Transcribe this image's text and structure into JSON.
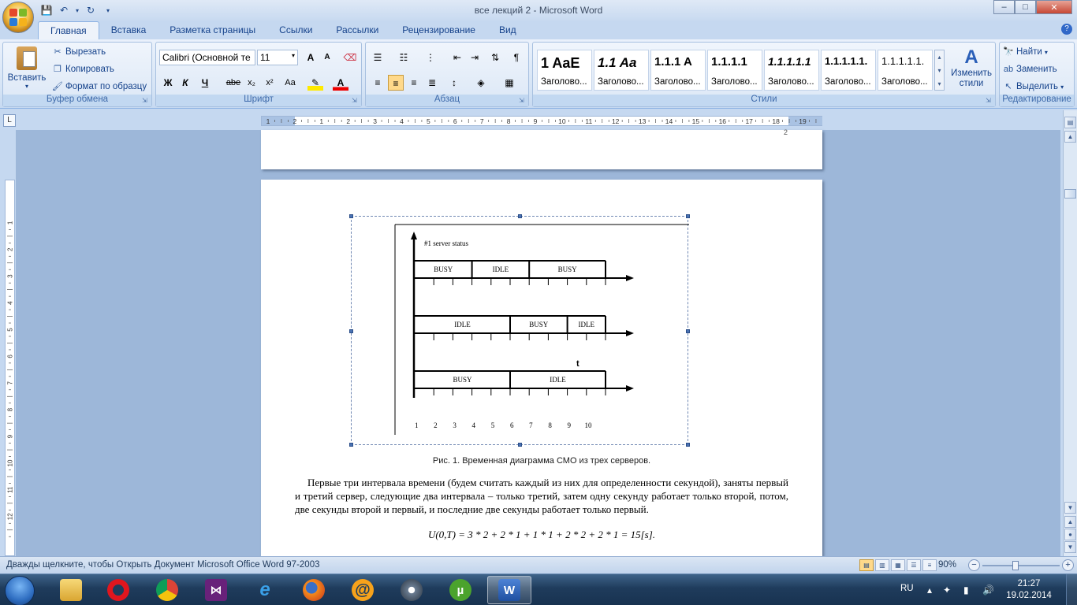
{
  "window": {
    "title": "все лекций 2 - Microsoft Word",
    "controls": [
      "–",
      "□",
      "✕"
    ]
  },
  "tabs": [
    "Главная",
    "Вставка",
    "Разметка страницы",
    "Ссылки",
    "Рассылки",
    "Рецензирование",
    "Вид"
  ],
  "clipboard": {
    "paste": "Вставить",
    "cut": "Вырезать",
    "copy": "Копировать",
    "format_painter": "Формат по образцу",
    "label": "Буфер обмена"
  },
  "font": {
    "name": "Calibri (Основной те",
    "size": "11",
    "label": "Шрифт",
    "bold": "Ж",
    "italic": "К",
    "underline": "Ч",
    "strike": "abe",
    "subscript": "x₂",
    "superscript": "x²",
    "change_case": "Aa",
    "grow": "A",
    "shrink": "A"
  },
  "paragraph": {
    "label": "Абзац"
  },
  "styles": {
    "label": "Стили",
    "items": [
      {
        "sample": "1  AaE",
        "name": "Заголово..."
      },
      {
        "sample": "1.1  Aa",
        "name": "Заголово..."
      },
      {
        "sample": "1.1.1  A",
        "name": "Заголово..."
      },
      {
        "sample": "1.1.1.1",
        "name": "Заголово..."
      },
      {
        "sample": "1.1.1.1.1",
        "name": "Заголово..."
      },
      {
        "sample": "1.1.1.1.1.",
        "name": "Заголово..."
      },
      {
        "sample": "1.1.1.1.1.",
        "name": "Заголово..."
      }
    ],
    "change_styles": "Изменить стили"
  },
  "editing": {
    "label": "Редактирование",
    "find": "Найти",
    "replace": "Заменить",
    "select": "Выделить"
  },
  "ruler": {
    "h_ticks": [
      "1",
      "2",
      "1",
      "2",
      "3",
      "4",
      "5",
      "6",
      "7",
      "8",
      "9",
      "10",
      "11",
      "12",
      "13",
      "14",
      "15",
      "16",
      "17",
      "18",
      "19"
    ],
    "v_ticks": [
      "1",
      "2",
      "3",
      "4",
      "5",
      "6",
      "7",
      "8",
      "9",
      "10",
      "11",
      "12"
    ]
  },
  "figure": {
    "y_label": "#1 server status",
    "timelines": [
      {
        "segments": [
          {
            "label": "BUSY",
            "from": 0,
            "to": 3
          },
          {
            "label": "IDLE",
            "from": 3,
            "to": 6
          },
          {
            "label": "BUSY",
            "from": 6,
            "to": 10
          }
        ]
      },
      {
        "segments": [
          {
            "label": "IDLE",
            "from": 0,
            "to": 5
          },
          {
            "label": "BUSY",
            "from": 5,
            "to": 8
          },
          {
            "label": "IDLE",
            "from": 8,
            "to": 10
          }
        ]
      },
      {
        "segments": [
          {
            "label": "BUSY",
            "from": 0,
            "to": 5
          },
          {
            "label": "IDLE",
            "from": 5,
            "to": 10
          }
        ]
      }
    ],
    "t_label": "t",
    "x_ticks": [
      "1",
      "2",
      "3",
      "4",
      "5",
      "6",
      "7",
      "8",
      "9",
      "10"
    ]
  },
  "caption": "Рис. 1. Временная диаграмма СМО из трех серверов.",
  "paragraph_text": "Первые три интервала времени (будем считать каждый из них для определенности секундой), заняты  первый и третий сервер, следующие два интервала – только третий, затем одну секунду работает только второй, потом, две секунды второй и первый, и последние две секунды работает только первый.",
  "formula": "U(0,T) = 3 * 2 + 2 * 1 + 1 * 1 + 2 * 2 + 2 * 1 = 15[s].",
  "status": {
    "text": "Дважды щелкните, чтобы Открыть Документ Microsoft Office Word 97-2003",
    "zoom": "90%"
  },
  "taskbar": {
    "lang": "RU",
    "time": "21:27",
    "date": "19.02.2014"
  }
}
